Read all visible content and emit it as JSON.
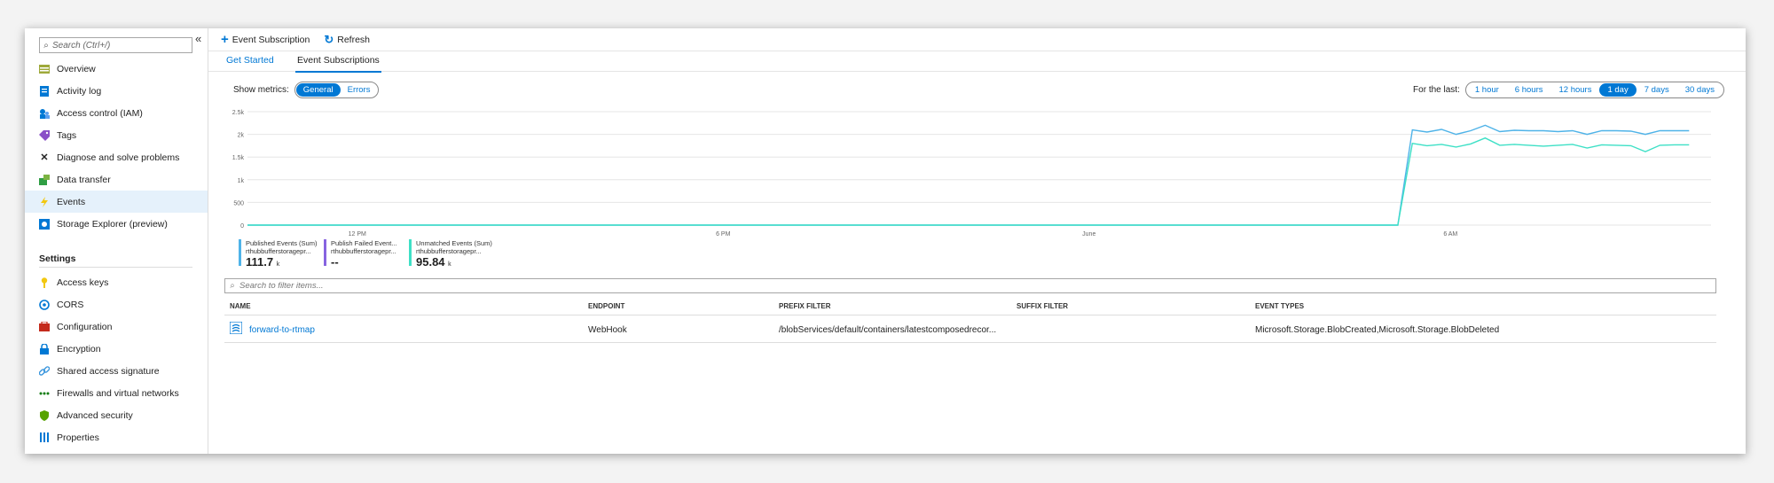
{
  "sidebar": {
    "search_placeholder": "Search (Ctrl+/)",
    "collapse": "«",
    "items": [
      {
        "label": "Overview",
        "icon": "overview-icon"
      },
      {
        "label": "Activity log",
        "icon": "activity-log-icon"
      },
      {
        "label": "Access control (IAM)",
        "icon": "iam-icon"
      },
      {
        "label": "Tags",
        "icon": "tag-icon"
      },
      {
        "label": "Diagnose and solve problems",
        "icon": "wrench-icon"
      },
      {
        "label": "Data transfer",
        "icon": "data-transfer-icon"
      },
      {
        "label": "Events",
        "icon": "lightning-icon",
        "active": true
      },
      {
        "label": "Storage Explorer (preview)",
        "icon": "storage-explorer-icon"
      }
    ],
    "settings_title": "Settings",
    "settings_items": [
      {
        "label": "Access keys",
        "icon": "key-icon"
      },
      {
        "label": "CORS",
        "icon": "cors-icon"
      },
      {
        "label": "Configuration",
        "icon": "configuration-icon"
      },
      {
        "label": "Encryption",
        "icon": "lock-icon"
      },
      {
        "label": "Shared access signature",
        "icon": "link-icon"
      },
      {
        "label": "Firewalls and virtual networks",
        "icon": "firewall-icon"
      },
      {
        "label": "Advanced security",
        "icon": "shield-icon"
      },
      {
        "label": "Properties",
        "icon": "properties-icon"
      }
    ]
  },
  "toolbar": {
    "event_subscription_label": "Event Subscription",
    "refresh_label": "Refresh"
  },
  "tabs": {
    "get_started": "Get Started",
    "event_subscriptions": "Event Subscriptions"
  },
  "metrics": {
    "show_label": "Show metrics:",
    "options": [
      "General",
      "Errors"
    ],
    "selected": "General"
  },
  "time_range": {
    "label": "For the last:",
    "options": [
      "1 hour",
      "6 hours",
      "12 hours",
      "1 day",
      "7 days",
      "30 days"
    ],
    "selected": "1 day"
  },
  "chart_data": {
    "type": "line",
    "y_ticks": [
      "2.5k",
      "2k",
      "1.5k",
      "1k",
      "500",
      "0"
    ],
    "x_ticks": [
      "12 PM",
      "6 PM",
      "June",
      "6 AM"
    ],
    "ylim": [
      0,
      2500
    ],
    "grid": true,
    "series": [
      {
        "name": "Published Events (Sum)",
        "color": "#4fb3e8",
        "values": [
          0,
          0,
          0,
          0,
          0,
          0,
          0,
          0,
          0,
          0,
          0,
          0,
          0,
          0,
          0,
          0,
          0,
          0,
          0,
          0,
          0,
          0,
          0,
          0,
          0,
          0,
          0,
          0,
          0,
          0,
          0,
          0,
          0,
          0,
          0,
          0,
          0,
          0,
          0,
          0,
          0,
          0,
          0,
          0,
          0,
          0,
          0,
          0,
          0,
          0,
          0,
          0,
          0,
          0,
          0,
          0,
          0,
          0,
          0,
          0,
          0,
          0,
          0,
          0,
          0,
          0,
          0,
          0,
          0,
          0,
          0,
          0,
          0,
          0,
          0,
          0,
          0,
          0,
          0,
          0,
          2100,
          2050,
          2110,
          2000,
          2080,
          2200,
          2060,
          2090,
          2080,
          2080,
          2060,
          2080,
          2000,
          2080,
          2080,
          2070,
          2000,
          2080,
          2080,
          2080
        ]
      },
      {
        "name": "Publish Failed Event...",
        "color": "#8764e0",
        "values": []
      },
      {
        "name": "Unmatched Events (Sum)",
        "color": "#3ee0c6",
        "values": [
          0,
          0,
          0,
          0,
          0,
          0,
          0,
          0,
          0,
          0,
          0,
          0,
          0,
          0,
          0,
          0,
          0,
          0,
          0,
          0,
          0,
          0,
          0,
          0,
          0,
          0,
          0,
          0,
          0,
          0,
          0,
          0,
          0,
          0,
          0,
          0,
          0,
          0,
          0,
          0,
          0,
          0,
          0,
          0,
          0,
          0,
          0,
          0,
          0,
          0,
          0,
          0,
          0,
          0,
          0,
          0,
          0,
          0,
          0,
          0,
          0,
          0,
          0,
          0,
          0,
          0,
          0,
          0,
          0,
          0,
          0,
          0,
          0,
          0,
          0,
          0,
          0,
          0,
          0,
          0,
          1800,
          1750,
          1780,
          1720,
          1790,
          1920,
          1760,
          1780,
          1760,
          1740,
          1760,
          1780,
          1700,
          1770,
          1760,
          1750,
          1620,
          1760,
          1770,
          1770
        ]
      }
    ]
  },
  "legend": [
    {
      "title": "Published Events (Sum)",
      "subtitle": "rthubbufferstoragepr...",
      "value": "111.7",
      "unit": "k",
      "color": "#4fb3e8"
    },
    {
      "title": "Publish Failed Event...",
      "subtitle": "rthubbufferstoragepr...",
      "value": "--",
      "unit": "",
      "color": "#8764e0"
    },
    {
      "title": "Unmatched Events (Sum)",
      "subtitle": "rthubbufferstoragepr...",
      "value": "95.84",
      "unit": "k",
      "color": "#3ee0c6"
    }
  ],
  "filter_placeholder": "Search to filter items...",
  "table": {
    "columns": [
      "NAME",
      "ENDPOINT",
      "PREFIX FILTER",
      "SUFFIX FILTER",
      "EVENT TYPES"
    ],
    "rows": [
      {
        "name": "forward-to-rtmap",
        "endpoint": "WebHook",
        "prefix": "/blobServices/default/containers/latestcomposedrecor...",
        "suffix": "",
        "event_types": "Microsoft.Storage.BlobCreated,Microsoft.Storage.BlobDeleted"
      }
    ]
  }
}
